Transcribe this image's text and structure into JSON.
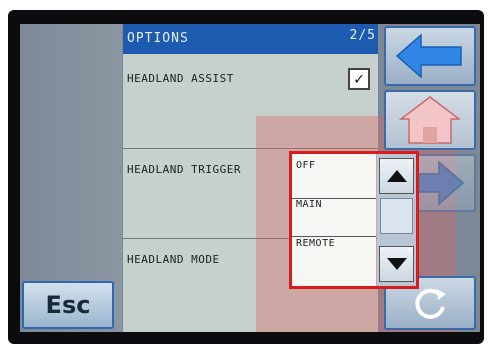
{
  "screen": {
    "title": "OPTIONS",
    "page_indicator": "2/5",
    "esc_label": "Esc"
  },
  "settings": [
    {
      "label": "HEADLAND ASSIST",
      "checked": true
    },
    {
      "label": "HEADLAND TRIGGER"
    },
    {
      "label": "HEADLAND MODE"
    }
  ],
  "dropdown": {
    "options": [
      "OFF",
      "MAIN",
      "REMOTE"
    ]
  },
  "icons": {
    "back": "left-arrow-icon",
    "home": "home-icon",
    "next": "right-arrow-icon",
    "refresh": "refresh-icon",
    "scroll_up": "triangle-up-icon",
    "scroll_down": "triangle-down-icon",
    "check": "checkmark-icon"
  },
  "colors": {
    "title_bar": "#1d5bb0",
    "highlight_border": "#d81c1c",
    "arrow_blue": "#2f86e6",
    "home_pink": "#f2c6c6"
  }
}
